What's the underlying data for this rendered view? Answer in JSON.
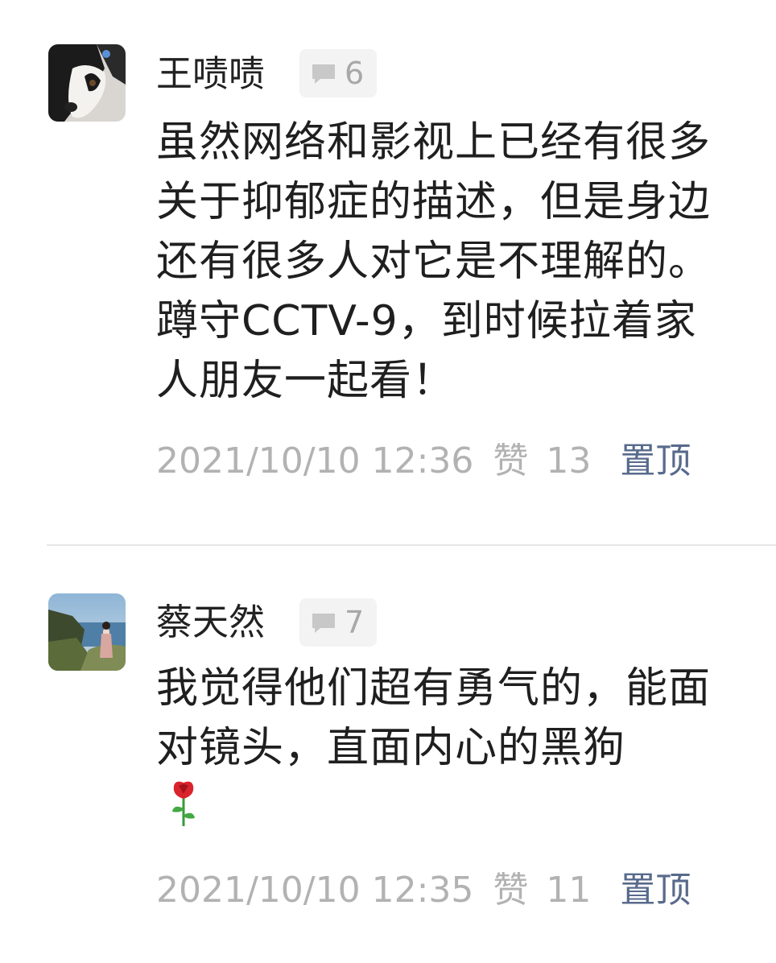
{
  "comments": [
    {
      "author": "王啧啧",
      "avatar_icon": "dog-avatar",
      "reply_count": "6",
      "text": "虽然网络和影视上已经有很多关于抑郁症的描述，但是身边还有很多人对它是不理解的。蹲守CCTV-9，到时候拉着家人朋友一起看！",
      "datetime": "2021/10/10 12:36",
      "likes_label": "赞",
      "likes": "13",
      "pin_label": "置顶"
    },
    {
      "author": "蔡天然",
      "avatar_icon": "seaside-avatar",
      "reply_count": "7",
      "text": "我觉得他们超有勇气的，能面对镜头，直面内心的黑狗",
      "emoji": "rose-emoji",
      "datetime": "2021/10/10 12:35",
      "likes_label": "赞",
      "likes": "11",
      "pin_label": "置顶"
    }
  ],
  "colors": {
    "text": "#1f1f1f",
    "meta": "#b2b2b2",
    "pin": "#586a8c",
    "badge_bg": "#f3f3f3",
    "divider": "#e6e6e6"
  }
}
